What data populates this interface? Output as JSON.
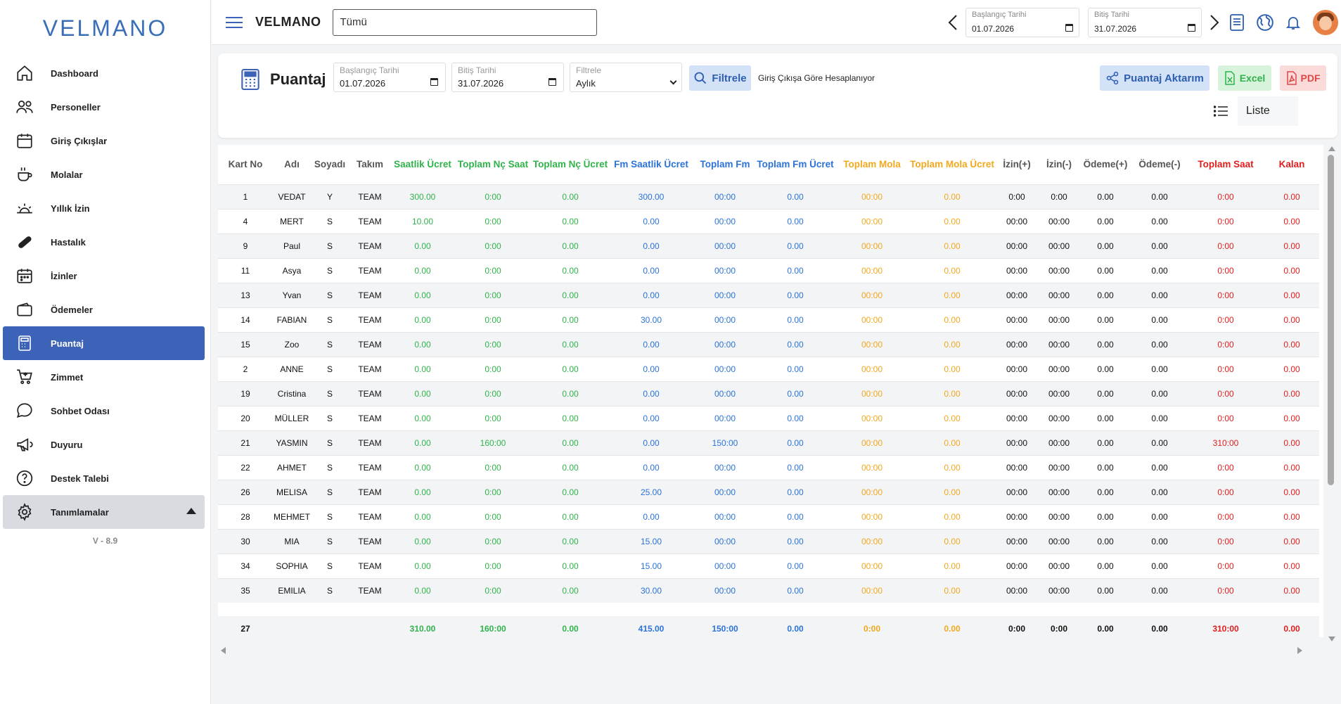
{
  "brand": "VELMANO",
  "sidebar": {
    "items": [
      {
        "label": "Dashboard",
        "icon": "home-icon"
      },
      {
        "label": "Personeller",
        "icon": "users-icon"
      },
      {
        "label": "Giriş Çıkışlar",
        "icon": "calendar-icon"
      },
      {
        "label": "Molalar",
        "icon": "coffee-icon"
      },
      {
        "label": "Yıllık İzin",
        "icon": "sunrise-icon"
      },
      {
        "label": "Hastalık",
        "icon": "pill-icon"
      },
      {
        "label": "İzinler",
        "icon": "calendar-dots-icon"
      },
      {
        "label": "Ödemeler",
        "icon": "wallet-icon"
      },
      {
        "label": "Puantaj",
        "icon": "calculator-icon"
      },
      {
        "label": "Zimmet",
        "icon": "cart-icon"
      },
      {
        "label": "Sohbet Odası",
        "icon": "chat-icon"
      },
      {
        "label": "Duyuru",
        "icon": "megaphone-icon"
      },
      {
        "label": "Destek Talebi",
        "icon": "help-icon"
      },
      {
        "label": "Tanımlamalar",
        "icon": "gear-icon"
      }
    ],
    "version": "V - 8.9"
  },
  "header": {
    "title": "VELMANO",
    "company_select": "Tümü",
    "start_label": "Başlangıç Tarihi",
    "start_value": "01.07.2026",
    "end_label": "Bitiş Tarihi",
    "end_value": "31.07.2026"
  },
  "toolbar": {
    "page_title": "Puantaj",
    "start_label": "Başlangıç Tarihi",
    "start_value": "01.07.2026",
    "end_label": "Bitiş Tarihi",
    "end_value": "31.07.2026",
    "period_label": "Filtrele",
    "period_value": "Aylık",
    "filter_button": "Filtrele",
    "note": "Giriş Çıkışa Göre Hesaplanıyor",
    "export_button": "Puantaj Aktarım",
    "excel_button": "Excel",
    "pdf_button": "PDF",
    "view_label": "Liste"
  },
  "table": {
    "columns": [
      {
        "label": "Kart No",
        "color": "dark"
      },
      {
        "label": "Adı",
        "color": "dark"
      },
      {
        "label": "Soyadı",
        "color": "dark"
      },
      {
        "label": "Takım",
        "color": "dark"
      },
      {
        "label": "Saatlik Ücret",
        "color": "green"
      },
      {
        "label": "Toplam Nç Saat",
        "color": "green"
      },
      {
        "label": "Toplam Nç Ücret",
        "color": "green"
      },
      {
        "label": "Fm Saatlik Ücret",
        "color": "blue"
      },
      {
        "label": "Toplam Fm",
        "color": "blue"
      },
      {
        "label": "Toplam Fm Ücret",
        "color": "blue"
      },
      {
        "label": "Toplam Mola",
        "color": "orange"
      },
      {
        "label": "Toplam Mola Ücret",
        "color": "orange"
      },
      {
        "label": "İzin(+)",
        "color": "dark"
      },
      {
        "label": "İzin(-)",
        "color": "dark"
      },
      {
        "label": "Ödeme(+)",
        "color": "dark"
      },
      {
        "label": "Ödeme(-)",
        "color": "dark"
      },
      {
        "label": "Toplam Saat",
        "color": "red"
      },
      {
        "label": "Kalan",
        "color": "red"
      }
    ],
    "rows": [
      [
        "1",
        "VEDAT",
        "Y",
        "TEAM",
        "300.00",
        "0:00",
        "0.00",
        "300.00",
        "00:00",
        "0.00",
        "00:00",
        "0.00",
        "0:00",
        "0:00",
        "0.00",
        "0.00",
        "0:00",
        "0.00"
      ],
      [
        "4",
        "MERT",
        "S",
        "TEAM",
        "10.00",
        "0:00",
        "0.00",
        "0.00",
        "00:00",
        "0.00",
        "00:00",
        "0.00",
        "00:00",
        "00:00",
        "0.00",
        "0.00",
        "0:00",
        "0.00"
      ],
      [
        "9",
        "Paul",
        "S",
        "TEAM",
        "0.00",
        "0:00",
        "0.00",
        "0.00",
        "00:00",
        "0.00",
        "00:00",
        "0.00",
        "00:00",
        "00:00",
        "0.00",
        "0.00",
        "0:00",
        "0.00"
      ],
      [
        "11",
        "Asya",
        "S",
        "TEAM",
        "0.00",
        "0:00",
        "0.00",
        "0.00",
        "00:00",
        "0.00",
        "00:00",
        "0.00",
        "00:00",
        "00:00",
        "0.00",
        "0.00",
        "0:00",
        "0.00"
      ],
      [
        "13",
        "Yvan",
        "S",
        "TEAM",
        "0.00",
        "0:00",
        "0.00",
        "0.00",
        "00:00",
        "0.00",
        "00:00",
        "0.00",
        "00:00",
        "00:00",
        "0.00",
        "0.00",
        "0:00",
        "0.00"
      ],
      [
        "14",
        "FABIAN",
        "S",
        "TEAM",
        "0.00",
        "0:00",
        "0.00",
        "30.00",
        "00:00",
        "0.00",
        "00:00",
        "0.00",
        "00:00",
        "00:00",
        "0.00",
        "0.00",
        "0:00",
        "0.00"
      ],
      [
        "15",
        "Zoo",
        "S",
        "TEAM",
        "0.00",
        "0:00",
        "0.00",
        "0.00",
        "00:00",
        "0.00",
        "00:00",
        "0.00",
        "00:00",
        "00:00",
        "0.00",
        "0.00",
        "0:00",
        "0.00"
      ],
      [
        "2",
        "ANNE",
        "S",
        "TEAM",
        "0.00",
        "0:00",
        "0.00",
        "0.00",
        "00:00",
        "0.00",
        "00:00",
        "0.00",
        "00:00",
        "00:00",
        "0.00",
        "0.00",
        "0:00",
        "0.00"
      ],
      [
        "19",
        "Cristina",
        "S",
        "TEAM",
        "0.00",
        "0:00",
        "0.00",
        "0.00",
        "00:00",
        "0.00",
        "00:00",
        "0.00",
        "00:00",
        "00:00",
        "0.00",
        "0.00",
        "0:00",
        "0.00"
      ],
      [
        "20",
        "MÜLLER",
        "S",
        "TEAM",
        "0.00",
        "0:00",
        "0.00",
        "0.00",
        "00:00",
        "0.00",
        "00:00",
        "0.00",
        "00:00",
        "00:00",
        "0.00",
        "0.00",
        "0:00",
        "0.00"
      ],
      [
        "21",
        "YASMIN",
        "S",
        "TEAM",
        "0.00",
        "160:00",
        "0.00",
        "0.00",
        "150:00",
        "0.00",
        "00:00",
        "0.00",
        "00:00",
        "00:00",
        "0.00",
        "0.00",
        "310:00",
        "0.00"
      ],
      [
        "22",
        "AHMET",
        "S",
        "TEAM",
        "0.00",
        "0:00",
        "0.00",
        "0.00",
        "00:00",
        "0.00",
        "00:00",
        "0.00",
        "00:00",
        "00:00",
        "0.00",
        "0.00",
        "0:00",
        "0.00"
      ],
      [
        "26",
        "MELISA",
        "S",
        "TEAM",
        "0.00",
        "0:00",
        "0.00",
        "25.00",
        "00:00",
        "0.00",
        "00:00",
        "0.00",
        "00:00",
        "00:00",
        "0.00",
        "0.00",
        "0:00",
        "0.00"
      ],
      [
        "28",
        "MEHMET",
        "S",
        "TEAM",
        "0.00",
        "0:00",
        "0.00",
        "0.00",
        "00:00",
        "0.00",
        "00:00",
        "0.00",
        "00:00",
        "00:00",
        "0.00",
        "0.00",
        "0:00",
        "0.00"
      ],
      [
        "30",
        "MIA",
        "S",
        "TEAM",
        "0.00",
        "0:00",
        "0.00",
        "15.00",
        "00:00",
        "0.00",
        "00:00",
        "0.00",
        "00:00",
        "00:00",
        "0.00",
        "0.00",
        "0:00",
        "0.00"
      ],
      [
        "34",
        "SOPHIA",
        "S",
        "TEAM",
        "0.00",
        "0:00",
        "0.00",
        "15.00",
        "00:00",
        "0.00",
        "00:00",
        "0.00",
        "00:00",
        "00:00",
        "0.00",
        "0.00",
        "0:00",
        "0.00"
      ],
      [
        "35",
        "EMILIA",
        "S",
        "TEAM",
        "0.00",
        "0:00",
        "0.00",
        "30.00",
        "00:00",
        "0.00",
        "00:00",
        "0.00",
        "00:00",
        "00:00",
        "0.00",
        "0.00",
        "0:00",
        "0.00"
      ]
    ],
    "totals": [
      "27",
      "",
      "",
      "",
      "310.00",
      "160:00",
      "0.00",
      "415.00",
      "150:00",
      "0.00",
      "0:00",
      "0.00",
      "0:00",
      "0:00",
      "0.00",
      "0.00",
      "310:00",
      "0.00"
    ]
  },
  "colors": {
    "accent": "#3d63b8",
    "green": "#2fb34a",
    "blue": "#2b73d8",
    "orange": "#f2a81d",
    "red": "#e01e1e"
  }
}
